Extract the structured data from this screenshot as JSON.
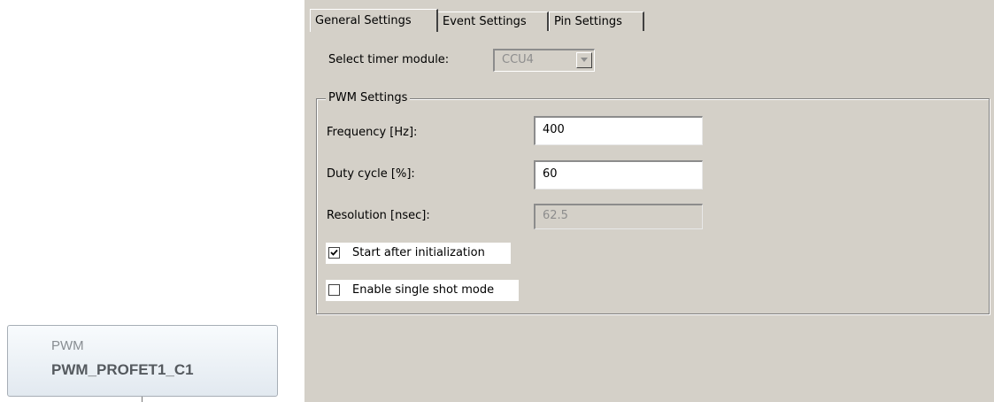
{
  "app_block": {
    "type_label": "PWM",
    "instance_name": "PWM_PROFET1_C1"
  },
  "tabs": [
    {
      "label": "General Settings",
      "active": true
    },
    {
      "label": "Event Settings",
      "active": false
    },
    {
      "label": "Pin Settings",
      "active": false
    }
  ],
  "general": {
    "timer_module_label": "Select timer module:",
    "timer_module_value": "CCU4",
    "timer_module_enabled": false
  },
  "pwm_settings": {
    "group_title": "PWM Settings",
    "frequency_label": "Frequency [Hz]:",
    "frequency_value": "400",
    "duty_label": "Duty cycle [%]:",
    "duty_value": "60",
    "resolution_label": "Resolution [nsec]:",
    "resolution_value": "62.5",
    "start_after_init_label": "Start after initialization",
    "start_after_init_checked": true,
    "single_shot_label": "Enable single shot mode",
    "single_shot_checked": false
  },
  "icons": {
    "dropdown_arrow": "chevron-down-icon",
    "checkmark": "checkmark-icon"
  },
  "colors": {
    "panel_bg": "#d4d0c8",
    "disabled_text": "#8d8d8d",
    "block_text": "#555a5f"
  }
}
